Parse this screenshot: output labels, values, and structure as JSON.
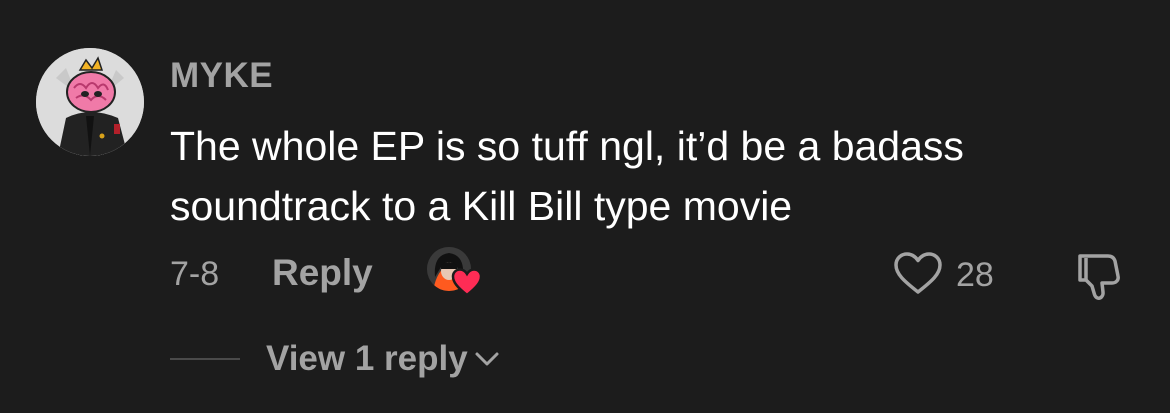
{
  "comment": {
    "username": "MYKE",
    "text": "The whole EP is so tuff ngl, it’d be a badass soundtrack to a Kill Bill type movie",
    "date": "7-8",
    "reply_label": "Reply",
    "like_count": "28",
    "liked_by_creator": true,
    "view_replies_label": "View 1 reply",
    "avatar_icon": "pink-brain-character-avatar",
    "creator_avatar_icon": "creator-avatar",
    "heart_icon": "heart-icon",
    "like_icon": "heart-outline-icon",
    "dislike_icon": "thumbs-down-icon",
    "chevron_icon": "chevron-down-icon"
  },
  "colors": {
    "background": "#1c1c1c",
    "primary_text": "#ffffff",
    "secondary_text": "#a3a3a3",
    "creator_heart": "#fe2c55"
  }
}
